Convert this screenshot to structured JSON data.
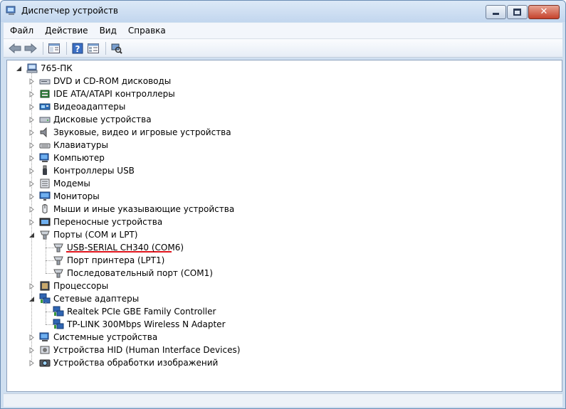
{
  "window": {
    "title": "Диспетчер устройств"
  },
  "menu": [
    "Файл",
    "Действие",
    "Вид",
    "Справка"
  ],
  "toolbar": [
    "back-icon",
    "forward-icon",
    "show-hide-tree-icon",
    "help-icon",
    "properties-icon",
    "scan-hardware-icon"
  ],
  "tree": {
    "root": "765-ПК",
    "items": [
      {
        "label": "DVD и CD-ROM дисководы",
        "icon": "dvd-drive-icon",
        "expanded": false
      },
      {
        "label": "IDE ATA/ATAPI контроллеры",
        "icon": "ide-controller-icon",
        "expanded": false
      },
      {
        "label": "Видеоадаптеры",
        "icon": "display-adapter-icon",
        "expanded": false
      },
      {
        "label": "Дисковые устройства",
        "icon": "disk-drive-icon",
        "expanded": false
      },
      {
        "label": "Звуковые, видео и игровые устройства",
        "icon": "sound-icon",
        "expanded": false
      },
      {
        "label": "Клавиатуры",
        "icon": "keyboard-icon",
        "expanded": false
      },
      {
        "label": "Компьютер",
        "icon": "computer-icon",
        "expanded": false
      },
      {
        "label": "Контроллеры USB",
        "icon": "usb-icon",
        "expanded": false
      },
      {
        "label": "Модемы",
        "icon": "modem-icon",
        "expanded": false
      },
      {
        "label": "Мониторы",
        "icon": "monitor-icon",
        "expanded": false
      },
      {
        "label": "Мыши и иные указывающие устройства",
        "icon": "mouse-icon",
        "expanded": false
      },
      {
        "label": "Переносные устройства",
        "icon": "portable-device-icon",
        "expanded": false
      },
      {
        "label": "Порты (COM и LPT)",
        "icon": "port-icon",
        "expanded": true,
        "children": [
          {
            "label": "USB-SERIAL CH340 (COM6)",
            "icon": "port-icon"
          },
          {
            "label": "Порт принтера (LPT1)",
            "icon": "port-icon"
          },
          {
            "label": "Последовательный порт (COM1)",
            "icon": "port-icon"
          }
        ]
      },
      {
        "label": "Процессоры",
        "icon": "processor-icon",
        "expanded": false
      },
      {
        "label": "Сетевые адаптеры",
        "icon": "network-adapter-icon",
        "expanded": true,
        "children": [
          {
            "label": "Realtek PCIe GBE Family Controller",
            "icon": "network-adapter-icon"
          },
          {
            "label": "TP-LINK 300Mbps Wireless N Adapter",
            "icon": "network-adapter-icon"
          }
        ]
      },
      {
        "label": "Системные устройства",
        "icon": "system-device-icon",
        "expanded": false
      },
      {
        "label": "Устройства HID (Human Interface Devices)",
        "icon": "hid-icon",
        "expanded": false
      },
      {
        "label": "Устройства обработки изображений",
        "icon": "imaging-device-icon",
        "expanded": false
      }
    ]
  },
  "colors": {
    "highlight_underline": "#e0141c",
    "title_bar": "#c2d6ee"
  }
}
